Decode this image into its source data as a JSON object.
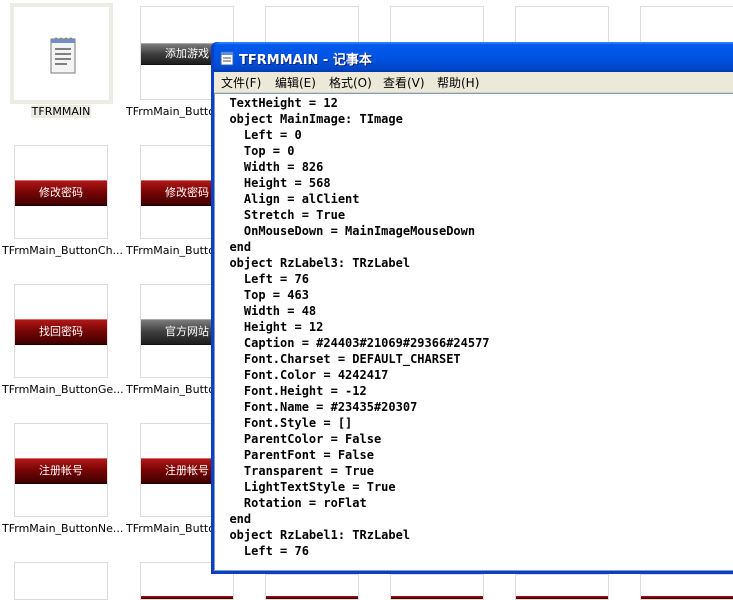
{
  "explorer": {
    "selected_file": "TFRMMAIN",
    "buttons": {
      "add_game": "添加游戏",
      "change_password": "修改密码",
      "official_site": "官方网站",
      "recover_password": "找回密码",
      "register_account": "注册帐号"
    },
    "captions": {
      "row1_col2": "TFrmMain_Butto",
      "row2_col1": "TFrmMain_ButtonCh...",
      "row2_col2": "TFrmMain_Butto",
      "row3_col1": "TFrmMain_ButtonGe...",
      "row3_col2": "TFrmMain_Butto",
      "row4_col1": "TFrmMain_ButtonNe...",
      "row4_col2": "TFrmMain_Butto"
    }
  },
  "notepad": {
    "title": "TFRMMAIN - 记事本",
    "menu": [
      "文件(F)",
      "编辑(E)",
      "格式(O)",
      "查看(V)",
      "帮助(H)"
    ],
    "lines": [
      "  TextHeight = 12",
      "  object MainImage: TImage",
      "    Left = 0",
      "    Top = 0",
      "    Width = 826",
      "    Height = 568",
      "    Align = alClient",
      "    Stretch = True",
      "    OnMouseDown = MainImageMouseDown",
      "  end",
      "  object RzLabel3: TRzLabel",
      "    Left = 76",
      "    Top = 463",
      "    Width = 48",
      "    Height = 12",
      "    Caption = #24403#21069#29366#24577",
      "    Font.Charset = DEFAULT_CHARSET",
      "    Font.Color = 4242417",
      "    Font.Height = -12",
      "    Font.Name = #23435#20307",
      "    Font.Style = []",
      "    ParentColor = False",
      "    ParentFont = False",
      "    Transparent = True",
      "    LightTextStyle = True",
      "    Rotation = roFlat",
      "  end",
      "  object RzLabel1: TRzLabel",
      "    Left = 76"
    ]
  },
  "colors": {
    "titlebar": "#0054e3",
    "menubar": "#ece9d8",
    "button_red": "#8b0a0a"
  },
  "icons": {
    "notepad_file": "notepad-document-icon",
    "notepad_app": "notepad-app-icon"
  }
}
